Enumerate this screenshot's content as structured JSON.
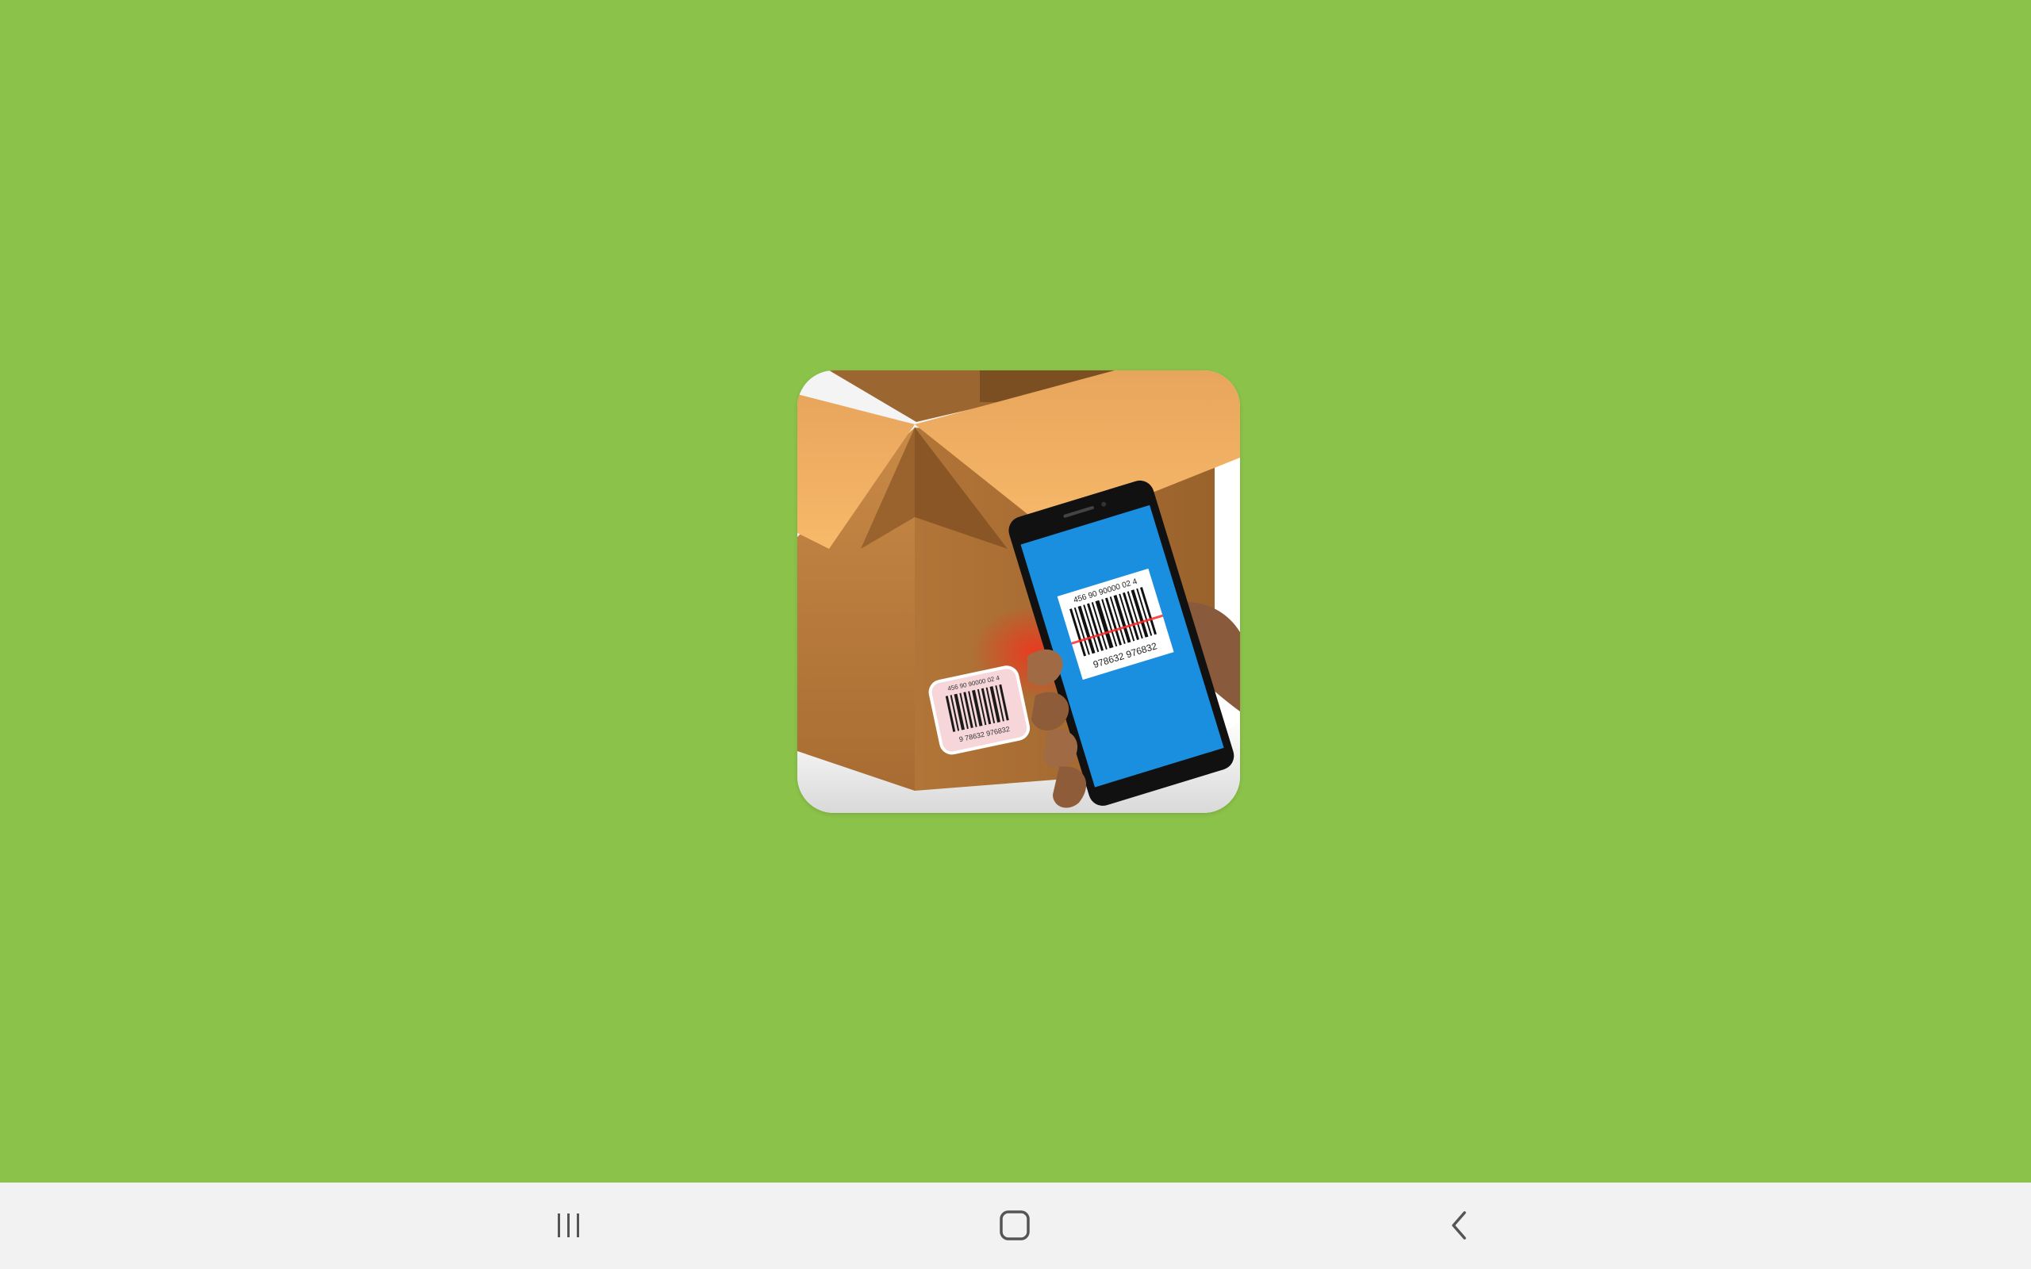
{
  "screen": {
    "background_color": "#8bc34a",
    "navbar_color": "#f2f2f2"
  },
  "splash": {
    "icon_name": "barcode-scanner-app-icon",
    "box_barcode_digits_top": "456 90 90000 02 4",
    "box_barcode_digits_bottom": "9 78632 976832",
    "phone_barcode_digits_top": "456 90 90000 02 4",
    "phone_barcode_digits_bottom": "978632 976832"
  },
  "navbar": {
    "recents_icon": "recents-icon",
    "home_icon": "home-icon",
    "back_icon": "back-icon"
  }
}
